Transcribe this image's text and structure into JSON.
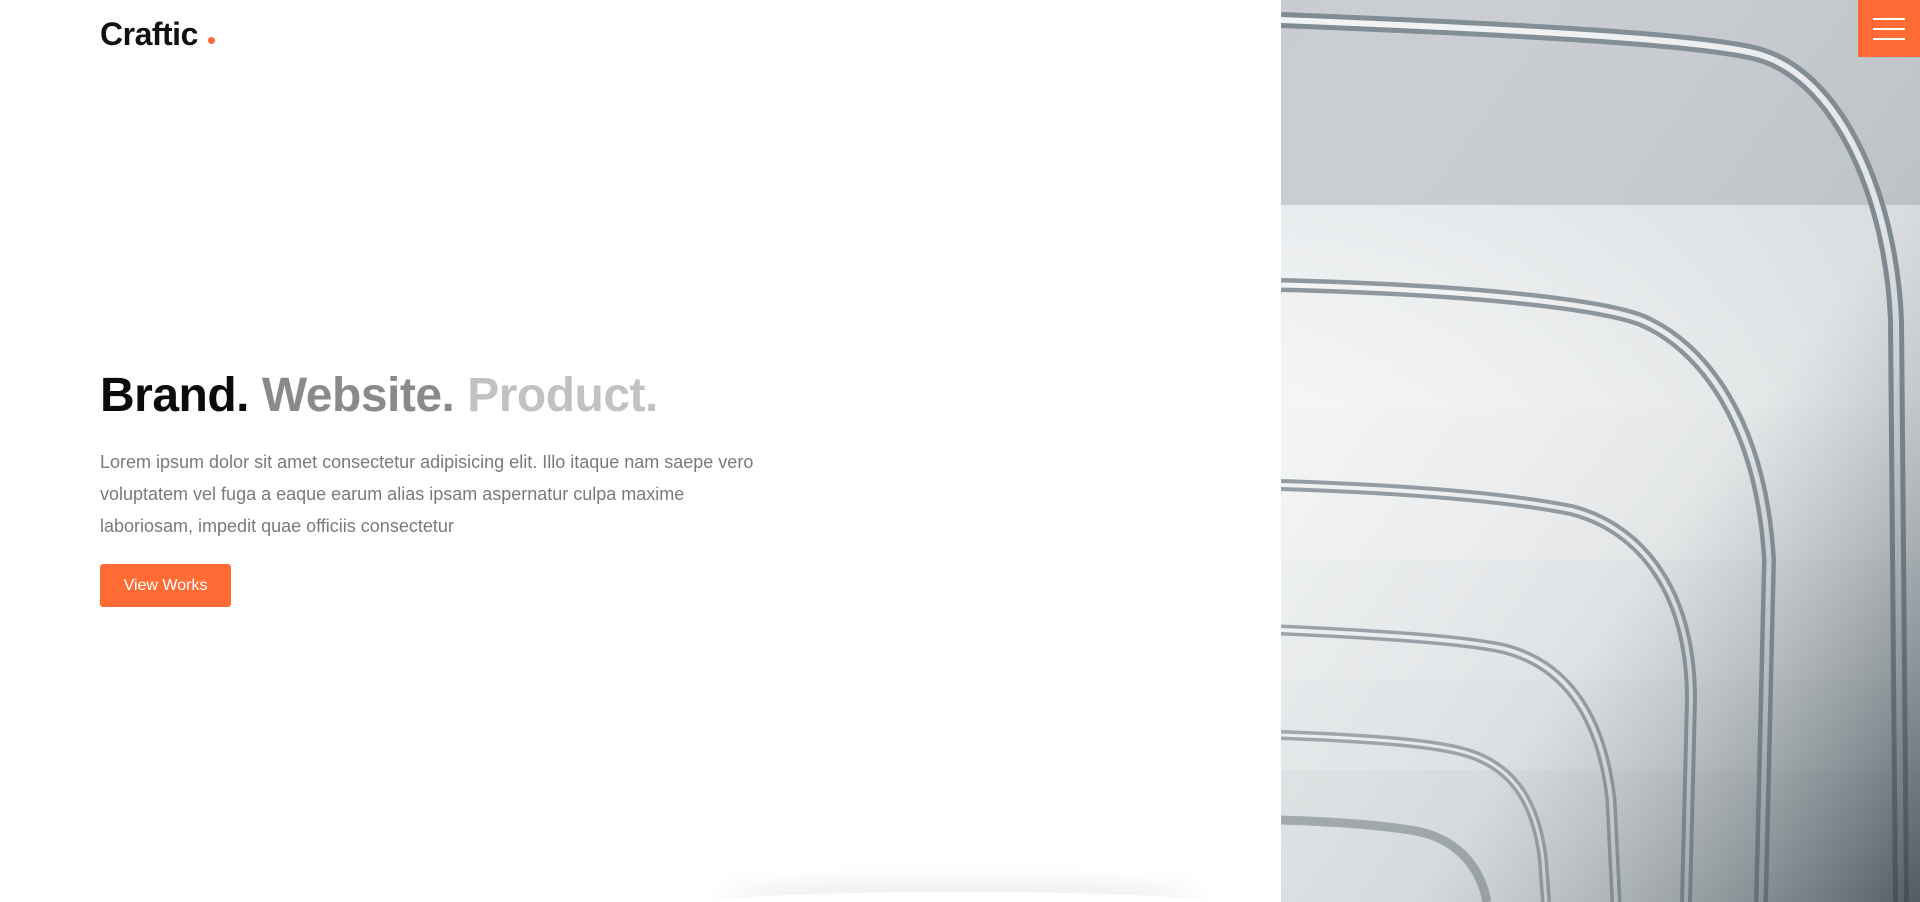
{
  "brand": {
    "name": "Craftic",
    "accent": "#ff6b35"
  },
  "header": {
    "menu_icon": "hamburger-menu-icon"
  },
  "hero": {
    "headline": {
      "part1": "Brand.",
      "part2": "Website.",
      "part3": "Product."
    },
    "intro": "Lorem ipsum dolor sit amet consectetur adipisicing elit. Illo itaque nam saepe vero voluptatem vel fuga a eaque earum alias ipsam aspernatur culpa maxime laboriosam, impedit quae officiis consectetur",
    "cta_label": "View Works"
  },
  "colors": {
    "accent": "#ff6b35",
    "headline_dark": "#0b0b0b",
    "headline_mid": "#8a8a8a",
    "headline_light": "#c2c2c2",
    "body_text": "#7a7a7a"
  }
}
